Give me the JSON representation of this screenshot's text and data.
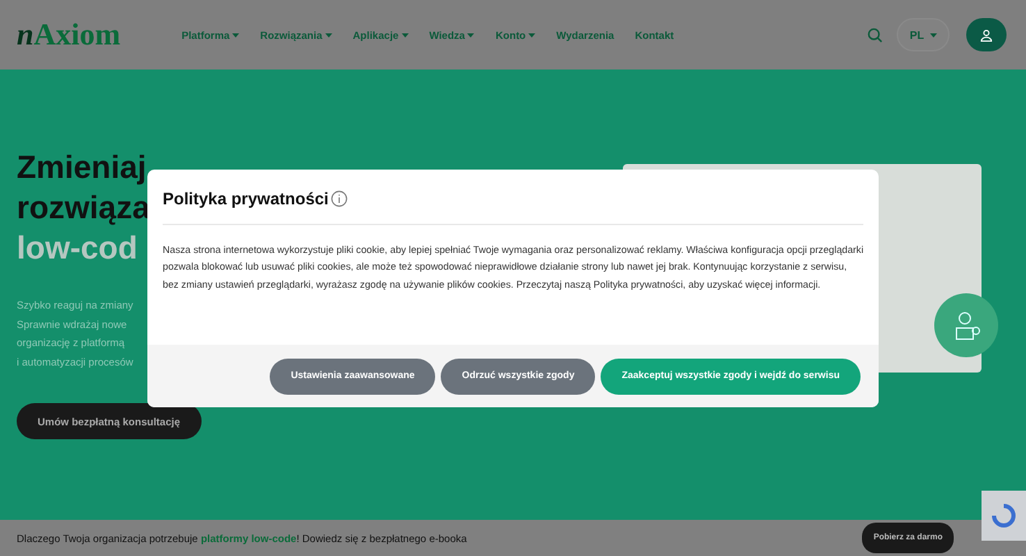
{
  "header": {
    "logo_prefix": "n",
    "logo_name": "Axiom",
    "nav": [
      {
        "label": "Platforma",
        "dropdown": true
      },
      {
        "label": "Rozwiązania",
        "dropdown": true
      },
      {
        "label": "Aplikacje",
        "dropdown": true
      },
      {
        "label": "Wiedza",
        "dropdown": true
      },
      {
        "label": "Konto",
        "dropdown": true
      },
      {
        "label": "Wydarzenia",
        "dropdown": false
      },
      {
        "label": "Kontakt",
        "dropdown": false
      }
    ],
    "language": "PL"
  },
  "hero": {
    "title_lines": [
      "Zmieniaj",
      "rozwiąza"
    ],
    "title_accent": "low-cod",
    "paragraph_lines": [
      "Szybko reaguj na zmiany",
      "Sprawnie wdrażaj nowe",
      "organizację z platformą",
      "i automatyzacji procesów"
    ],
    "cta": "Umów bezpłatną konsultację"
  },
  "cookie_dialog": {
    "title": "Polityka prywatności",
    "body": "Nasza strona internetowa wykorzystuje pliki cookie, aby lepiej spełniać Twoje wymagania oraz personalizować reklamy. Właściwa konfiguracja opcji przeglądarki pozwala blokować lub usuwać pliki cookies, ale może też spowodować nieprawidłowe działanie strony lub nawet jej brak. Kontynuując korzystanie z serwisu, bez zmiany ustawień przeglądarki, wyrażasz zgodę na używanie plików cookies. Przeczytaj naszą Polityka prywatności, aby uzyskać więcej informacji.",
    "buttons": [
      {
        "label": "Ustawienia zaawansowane",
        "kind": "secondary"
      },
      {
        "label": "Odrzuć wszystkie zgody",
        "kind": "secondary"
      },
      {
        "label": "Zaakceptuj wszystkie zgody i wejdź do serwisu",
        "kind": "primary"
      }
    ]
  },
  "promo_bar": {
    "text": "Dlaczego Twoja organizacja potrzebuje **platformy low-code**! Dowiedz się z bezpłatnego e-booka",
    "button": "Pobierz za darmo"
  }
}
